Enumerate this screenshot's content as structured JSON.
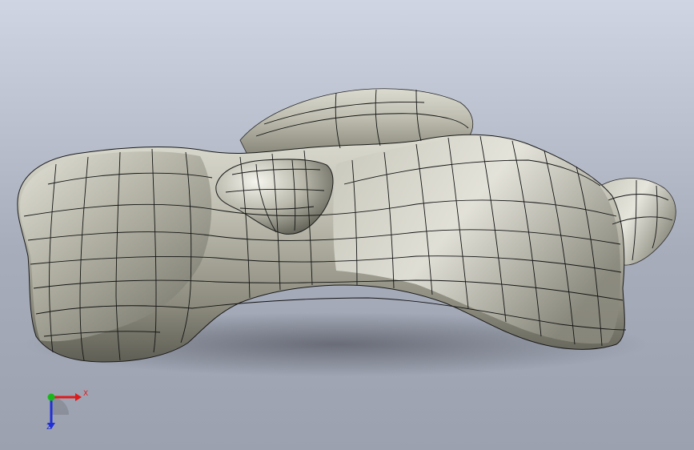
{
  "viewport": {
    "background_top": "#cfd5e3",
    "background_bottom": "#9ba1af"
  },
  "model": {
    "icon": "freeform-surface-mesh",
    "surface_color": "#b9b8ab",
    "wire_color": "#141414"
  },
  "triad": {
    "x_label": "X",
    "z_label": "Z",
    "x_color": "#e01b1b",
    "y_color": "#18b81a",
    "z_color": "#2030d8"
  }
}
